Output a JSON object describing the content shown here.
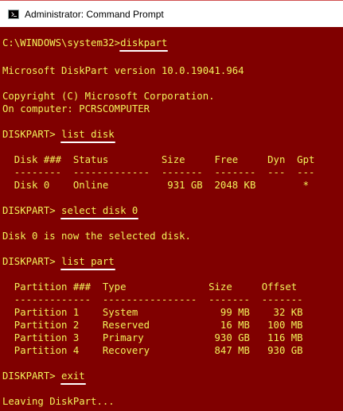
{
  "window": {
    "title": "Administrator: Command Prompt"
  },
  "icons": {
    "app_icon": "cmd-icon"
  },
  "colors": {
    "console_bg": "#800000",
    "console_text": "#f2f25a",
    "titlebar_bg": "#ffffff",
    "underline": "#ffffff"
  },
  "console": {
    "prompt_sys": "C:\\WINDOWS\\system32>",
    "cmd_diskpart": "diskpart",
    "version_line": "Microsoft DiskPart version 10.0.19041.964",
    "copyright_line": "Copyright (C) Microsoft Corporation.",
    "computer_line": "On computer: PCRSCOMPUTER",
    "prompt_dp": "DISKPART> ",
    "cmd_list_disk": "list disk",
    "disk_header": "  Disk ###  Status         Size     Free     Dyn  Gpt",
    "disk_sep": "  --------  -------------  -------  -------  ---  ---",
    "disk_row": "  Disk 0    Online          931 GB  2048 KB        *",
    "cmd_select_disk": "select disk 0",
    "selected_msg": "Disk 0 is now the selected disk.",
    "cmd_list_part": "list part",
    "part_header": "  Partition ###  Type              Size     Offset",
    "part_sep": "  -------------  ----------------  -------  -------",
    "part_rows": [
      "  Partition 1    System              99 MB    32 KB",
      "  Partition 2    Reserved            16 MB   100 MB",
      "  Partition 3    Primary            930 GB   116 MB",
      "  Partition 4    Recovery           847 MB   930 GB"
    ],
    "cmd_exit": "exit",
    "leaving_msg": "Leaving DiskPart..."
  }
}
